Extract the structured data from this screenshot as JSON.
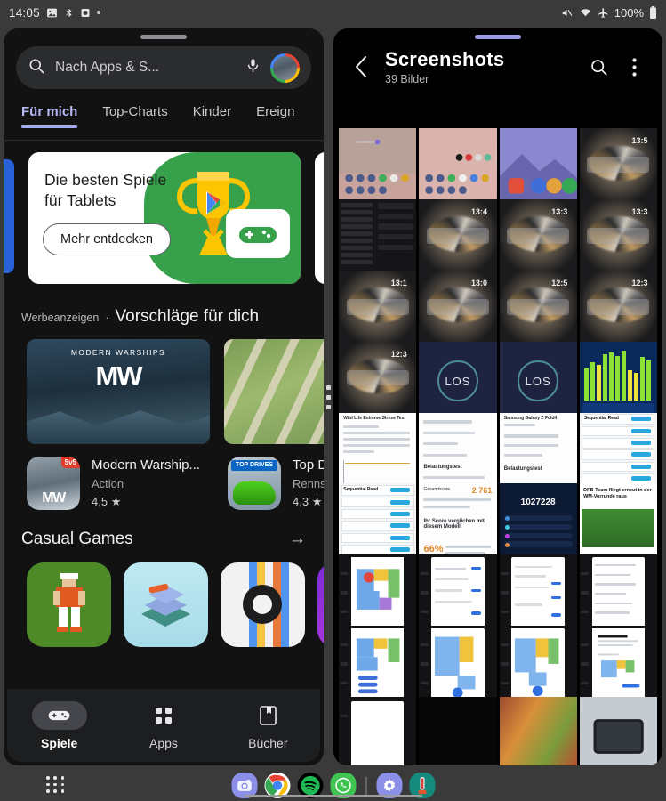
{
  "status_bar": {
    "time": "14:05",
    "left_icons": [
      "image-icon",
      "bluetooth-audio-icon",
      "alarm-icon",
      "more-dot-icon"
    ],
    "right_icons": [
      "mute-icon",
      "wifi-icon",
      "airplane-mode-icon"
    ],
    "battery_percent": "100%"
  },
  "play_store": {
    "search": {
      "placeholder": "Nach Apps & S...",
      "search_icon": "search-icon",
      "mic_icon": "microphone-icon",
      "avatar": "user-avatar"
    },
    "tabs": [
      {
        "label": "Für mich",
        "active": true
      },
      {
        "label": "Top-Charts",
        "active": false
      },
      {
        "label": "Kinder",
        "active": false
      },
      {
        "label": "Ereign",
        "active": false
      }
    ],
    "promo": {
      "title_line1": "Die besten Spiele",
      "title_line2": "für Tablets",
      "button": "Mehr entdecken",
      "art": [
        "trophy-icon",
        "play-logo-icon",
        "gamepad-icon"
      ]
    },
    "ads_section": {
      "eyebrow": "Werbeanzeigen",
      "separator": "·",
      "title": "Vorschläge für dich",
      "banners": [
        {
          "name": "MODERN WARSHIPS",
          "logo": "MW"
        },
        {
          "name": "Top Drives",
          "logo": "TOP DRIVES"
        }
      ],
      "apps": [
        {
          "name": "Modern Warship...",
          "category": "Action",
          "rating": "4,5",
          "badge": "5v5"
        },
        {
          "name": "Top Dr",
          "category": "Rennsp",
          "rating": "4,3",
          "badge": "TOP DRIVES"
        }
      ]
    },
    "casual": {
      "title": "Casual Games",
      "arrow_icon": "arrow-right-icon",
      "tiles": [
        "retro-pixel-game",
        "block-puzzle-game",
        "ring-rainbow-game",
        "purple-magic-game"
      ]
    },
    "bottom_nav": [
      {
        "label": "Spiele",
        "icon": "gamepad-icon",
        "active": true
      },
      {
        "label": "Apps",
        "icon": "grid-icon",
        "active": false
      },
      {
        "label": "Bücher",
        "icon": "book-bookmark-icon",
        "active": false
      }
    ]
  },
  "gallery": {
    "back_icon": "chevron-left-icon",
    "title": "Screenshots",
    "subtitle": "39 Bilder",
    "search_icon": "search-icon",
    "menu_icon": "more-vertical-icon",
    "thumbnails": [
      {
        "kind": "home-screen-1"
      },
      {
        "kind": "home-screen-2"
      },
      {
        "kind": "home-screen-3"
      },
      {
        "kind": "lock-screen",
        "time": "13:5"
      },
      {
        "kind": "settings-list"
      },
      {
        "kind": "lock-screen",
        "time": "13:4"
      },
      {
        "kind": "lock-screen",
        "time": "13:3"
      },
      {
        "kind": "lock-screen",
        "time": "13:3"
      },
      {
        "kind": "lock-screen",
        "time": "13:1"
      },
      {
        "kind": "lock-screen",
        "time": "13:0"
      },
      {
        "kind": "lock-screen",
        "time": "12:5"
      },
      {
        "kind": "lock-screen",
        "time": "12:3"
      },
      {
        "kind": "lock-screen",
        "time": "12:3"
      },
      {
        "kind": "los-benchmark",
        "label": "LOS"
      },
      {
        "kind": "los-benchmark",
        "label": "LOS"
      },
      {
        "kind": "bar-chart-benchmark"
      },
      {
        "kind": "stress-test-report",
        "label": "Wild Life Extreme Stress Test"
      },
      {
        "kind": "score-report"
      },
      {
        "kind": "device-report",
        "label": "Samsung Galaxy Z Fold4"
      },
      {
        "kind": "benchmark-list",
        "label": "Sequential Read"
      },
      {
        "kind": "benchmark-list",
        "label": "Sequential Read"
      },
      {
        "kind": "total-score",
        "label": "2 761"
      },
      {
        "kind": "dark-score-list",
        "label": "1027228"
      },
      {
        "kind": "news-article",
        "label": "DFB-Team fliegt erneut in der WM-Vorrunde raus"
      },
      {
        "kind": "robot-map"
      },
      {
        "kind": "settings-toggles"
      },
      {
        "kind": "settings-toggles"
      },
      {
        "kind": "settings-list-app"
      },
      {
        "kind": "robot-map"
      },
      {
        "kind": "robot-map-full"
      },
      {
        "kind": "robot-map-full"
      },
      {
        "kind": "dialog-sheet"
      },
      {
        "kind": "white-sheet"
      },
      {
        "kind": "black-screen"
      },
      {
        "kind": "food-photo"
      },
      {
        "kind": "phone-photo"
      }
    ]
  },
  "taskbar": {
    "apps_button": "all-apps-icon",
    "icons": [
      {
        "name": "camera-icon"
      },
      {
        "name": "chrome-icon"
      },
      {
        "name": "spotify-icon"
      },
      {
        "name": "whatsapp-icon"
      },
      {
        "name": "separator"
      },
      {
        "name": "settings-icon"
      },
      {
        "name": "thermometer-app-icon"
      }
    ],
    "home_handle": "home-gesture-handle"
  },
  "colors": {
    "accent_purple": "#a5abf0",
    "play_green": "#37a04b",
    "play_yellow": "#f5b500",
    "background": "#3a3a3a",
    "panel_dark": "#121212"
  }
}
